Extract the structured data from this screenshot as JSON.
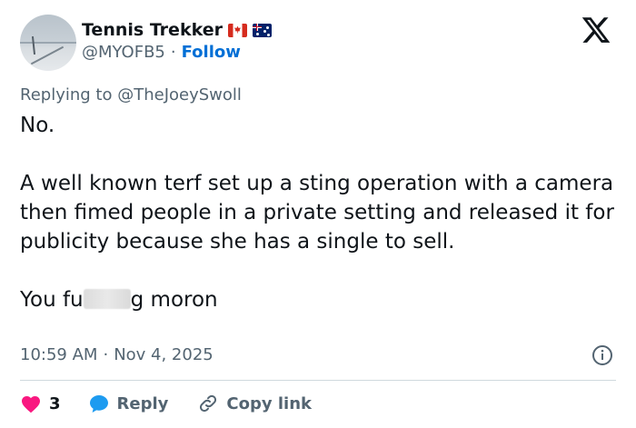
{
  "author": {
    "display_name": "Tennis Trekker",
    "handle": "@MYOFB5",
    "separator": "·",
    "follow_label": "Follow",
    "flags": [
      "canada-flag-icon",
      "australia-flag-icon"
    ]
  },
  "reply_context": {
    "prefix": "Replying to",
    "mention": "@TheJoeySwoll"
  },
  "tweet": {
    "line1": "No.",
    "paragraph2": "A well known terf set up a sting operation with a camera then fimed people in a private setting and released it for publicity because she has a single to sell.",
    "line3_start": "You fu",
    "line3_end": "g moron"
  },
  "meta": {
    "time": "10:59 AM",
    "separator": "·",
    "date": "Nov 4, 2025"
  },
  "actions": {
    "like_count": "3",
    "reply_label": "Reply",
    "copy_link_label": "Copy link"
  },
  "colors": {
    "text": "#0f1419",
    "secondary": "#536471",
    "link": "#006fd6",
    "like": "#f91880",
    "reply": "#1d9bf0",
    "divider": "#cfd9de"
  }
}
